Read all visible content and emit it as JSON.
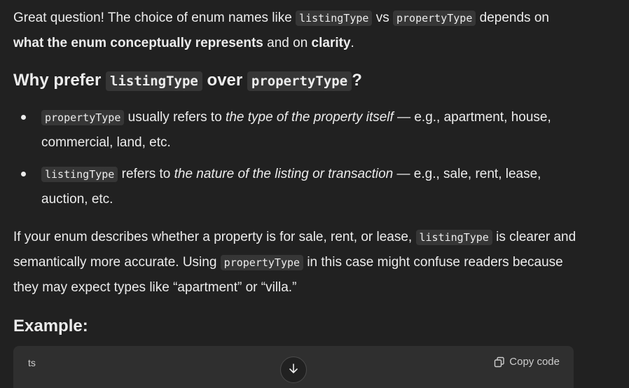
{
  "intro": {
    "t1": "Great question! The choice of enum names like ",
    "c1": "listingType",
    "t2": " vs ",
    "c2": "propertyType",
    "t3": " depends on ",
    "b1": "what the enum conceptually represents",
    "t4": " and on ",
    "b2": "clarity",
    "t5": "."
  },
  "why_heading": {
    "t1": "Why prefer ",
    "c1": "listingType",
    "t2": " over ",
    "c2": "propertyType",
    "t3": "?"
  },
  "bullets": [
    {
      "code": "propertyType",
      "t1": " usually refers to ",
      "em": "the type of the property itself",
      "t2": " — e.g., apartment, house, commercial, land, etc."
    },
    {
      "code": "listingType",
      "t1": " refers to ",
      "em": "the nature of the listing or transaction",
      "t2": " — e.g., sale, rent, lease, auction, etc."
    }
  ],
  "para2": {
    "t1": "If your enum describes whether a property is for sale, rent, or lease, ",
    "c1": "listingType",
    "t2": " is clearer and semantically more accurate. Using ",
    "c2": "propertyType",
    "t3": " in this case might confuse readers because they may expect types like “apartment” or “villa.”"
  },
  "example_heading": "Example:",
  "code_block": {
    "language": "ts",
    "copy_label": "Copy code"
  },
  "icons": {
    "copy": "copy-icon",
    "scroll": "arrow-down-icon"
  }
}
